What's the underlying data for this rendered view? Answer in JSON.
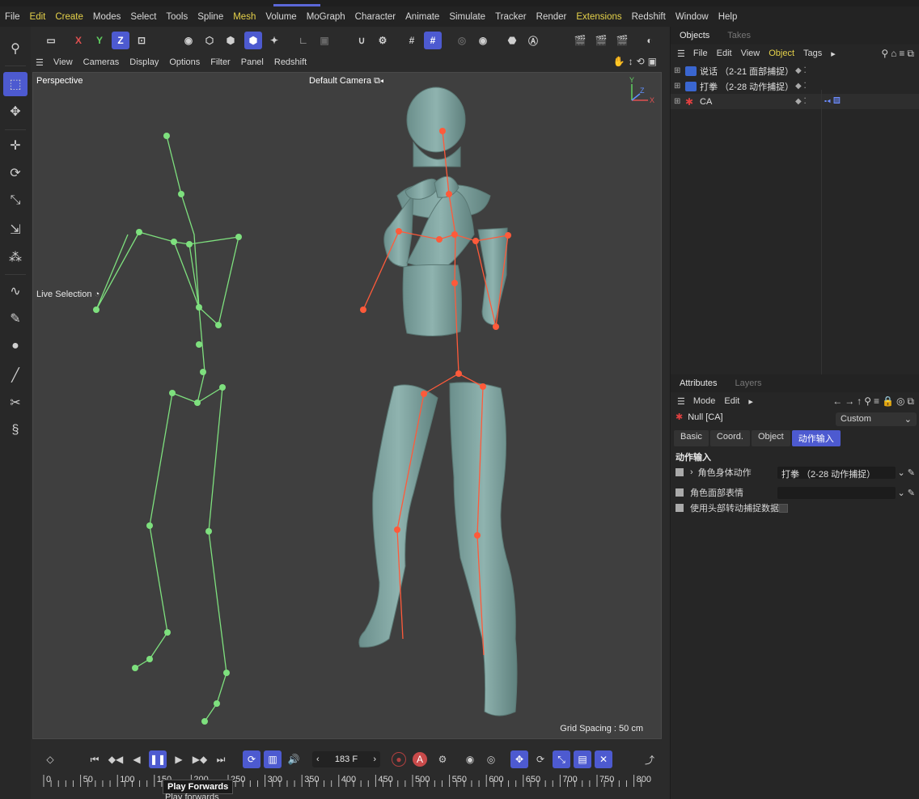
{
  "menubar": {
    "items": [
      {
        "label": "File",
        "accent": false
      },
      {
        "label": "Edit",
        "accent": true
      },
      {
        "label": "Create",
        "accent": true
      },
      {
        "label": "Modes",
        "accent": false
      },
      {
        "label": "Select",
        "accent": false
      },
      {
        "label": "Tools",
        "accent": false
      },
      {
        "label": "Spline",
        "accent": false
      },
      {
        "label": "Mesh",
        "accent": true
      },
      {
        "label": "Volume",
        "accent": false
      },
      {
        "label": "MoGraph",
        "accent": false
      },
      {
        "label": "Character",
        "accent": false
      },
      {
        "label": "Animate",
        "accent": false
      },
      {
        "label": "Simulate",
        "accent": false
      },
      {
        "label": "Tracker",
        "accent": false
      },
      {
        "label": "Render",
        "accent": false
      },
      {
        "label": "Extensions",
        "accent": true
      },
      {
        "label": "Redshift",
        "accent": false
      },
      {
        "label": "Window",
        "accent": false
      },
      {
        "label": "Help",
        "accent": false
      }
    ]
  },
  "maintoolbar": {
    "axis_x": "X",
    "axis_y": "Y",
    "axis_z": "Z"
  },
  "viewport": {
    "menu": [
      "View",
      "Cameras",
      "Display",
      "Options",
      "Filter",
      "Panel",
      "Redshift"
    ],
    "label": "Perspective",
    "camera": "Default Camera",
    "camera_icon": "camera-icon",
    "grid_spacing": "Grid Spacing : 50 cm",
    "tool_label": "Live Selection",
    "axis_labels": {
      "y": "Y",
      "x": "X",
      "z": "Z"
    }
  },
  "timeline": {
    "frame": "183 F",
    "ruler": [
      "0",
      "50",
      "100",
      "150",
      "200",
      "250",
      "300",
      "350",
      "400",
      "450",
      "500",
      "550",
      "600",
      "650",
      "700",
      "750",
      "800"
    ],
    "tooltip_title": "Play Forwards",
    "tooltip_sub": "Play forwards",
    "record_label": "A"
  },
  "objects_panel": {
    "tabs": [
      "Objects",
      "Takes"
    ],
    "menu": [
      "File",
      "Edit",
      "View",
      "Object",
      "Tags"
    ],
    "items": [
      {
        "name": "说话 （2-21 面部捕捉）",
        "icon": "take-icon"
      },
      {
        "name": "打拳 （2-28 动作捕捉）",
        "icon": "take-icon"
      },
      {
        "name": "CA",
        "icon": "character-icon"
      }
    ]
  },
  "attributes_panel": {
    "tabs": [
      "Attributes",
      "Layers"
    ],
    "menu": [
      "Mode",
      "Edit"
    ],
    "object_name": "Null [CA]",
    "preset": "Custom",
    "subtabs": [
      "Basic",
      "Coord.",
      "Object",
      "动作输入"
    ],
    "active_subtab": "动作输入",
    "group_title": "动作输入",
    "rows": [
      {
        "label": "角色身体动作",
        "value": "打拳 （2-28 动作捕捉）",
        "expandable": true
      },
      {
        "label": "角色面部表情",
        "value": "",
        "expandable": false
      },
      {
        "label": "使用头部转动捕捉数据",
        "value": "",
        "checkbox": true
      }
    ]
  },
  "colors": {
    "accent": "#4d5ad0",
    "menu_highlight": "#e6d24a",
    "skeleton_green": "#7ee07e",
    "skeleton_red": "#ff5a3a",
    "figure": "#7fa3a0"
  }
}
